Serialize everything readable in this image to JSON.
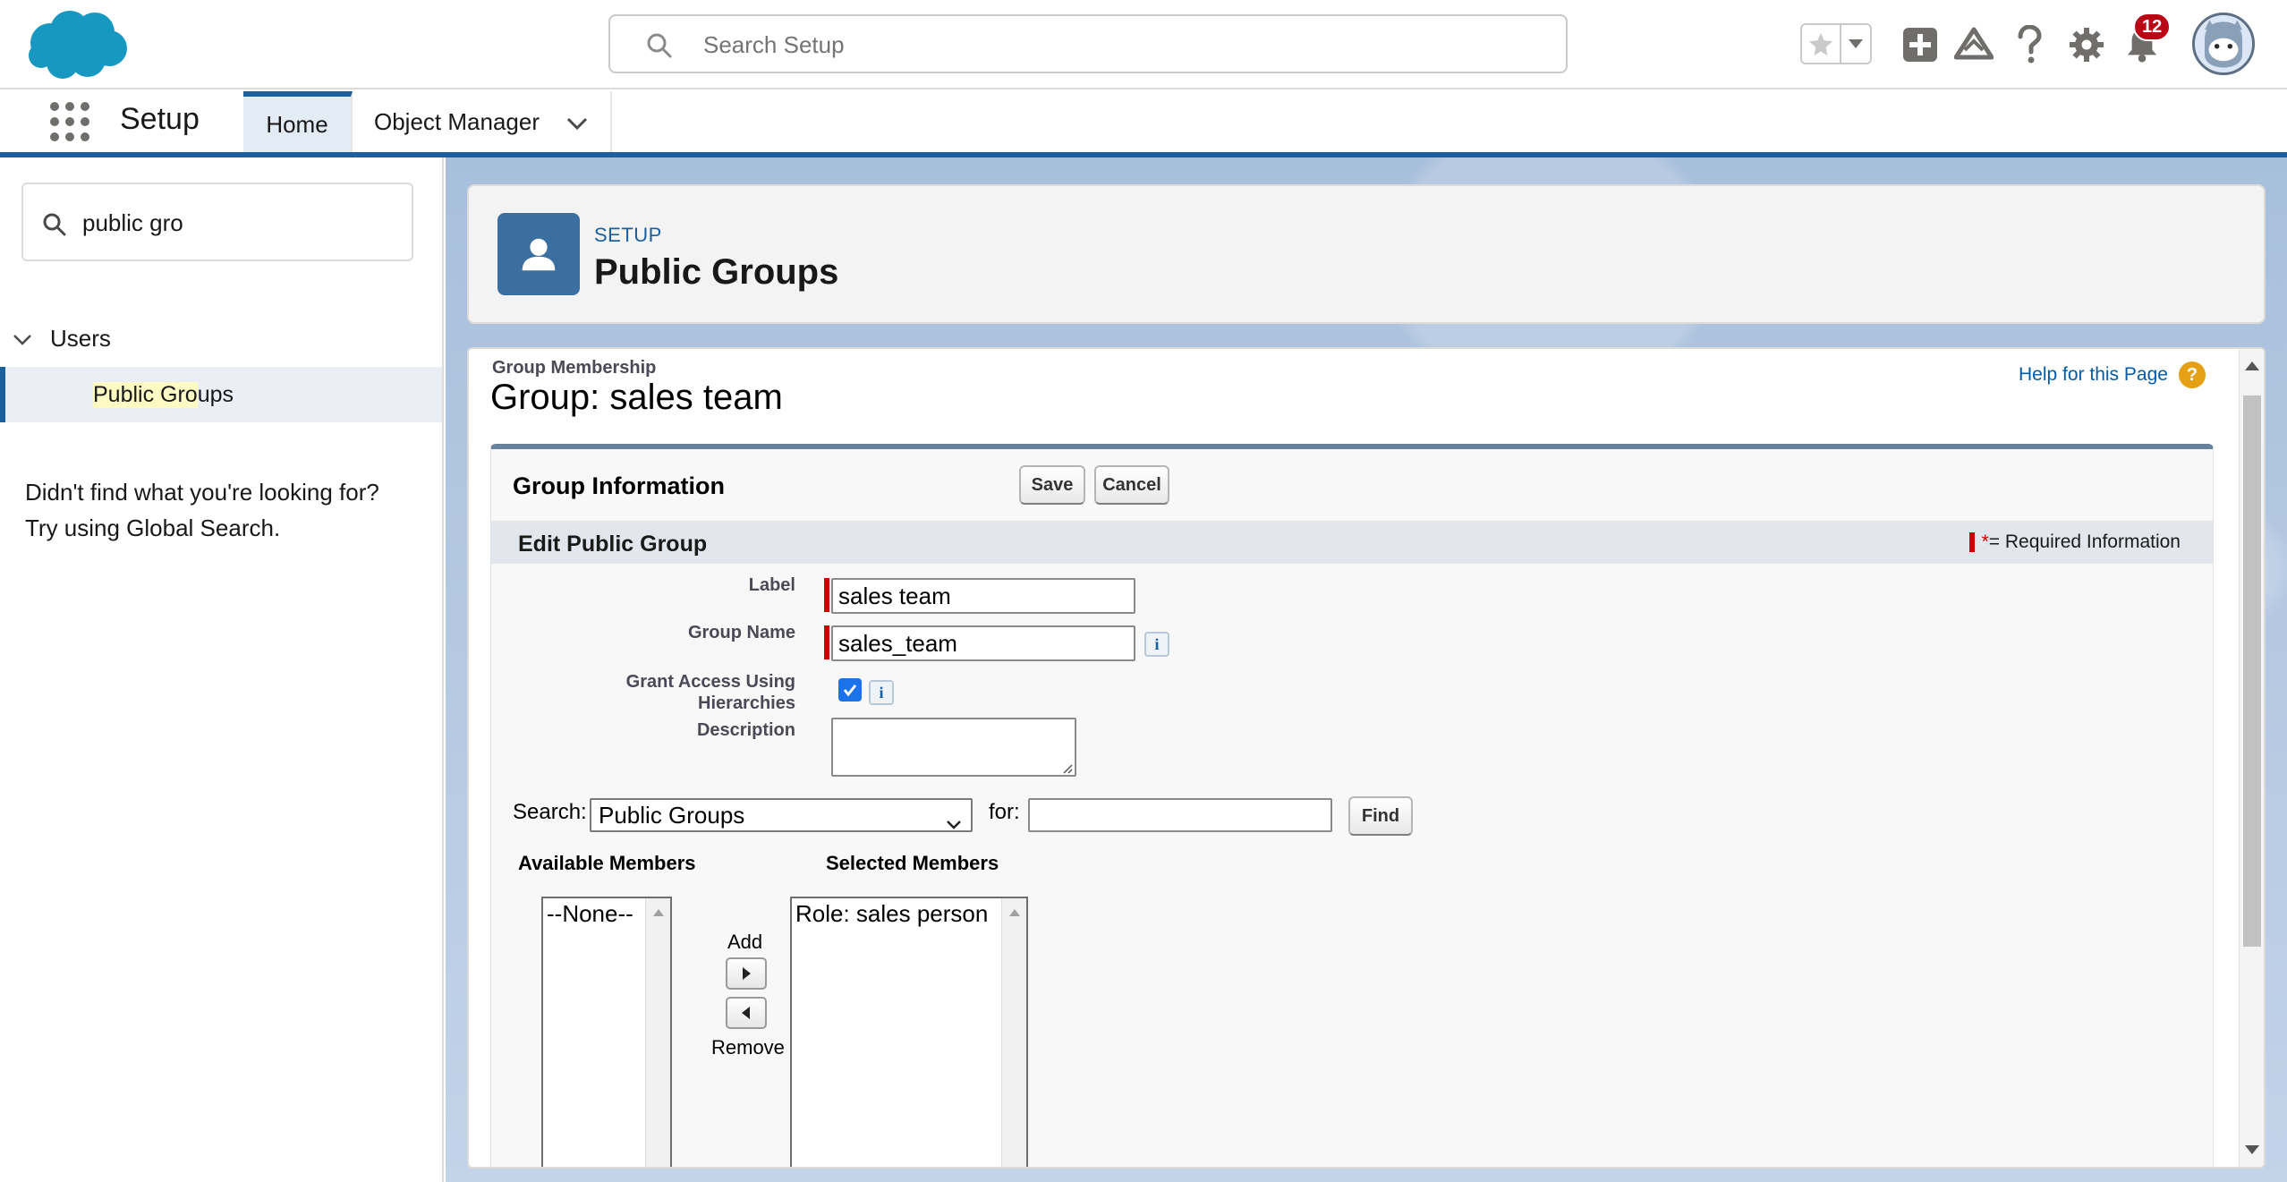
{
  "header": {
    "search_placeholder": "Search Setup",
    "notification_count": "12"
  },
  "context_bar": {
    "app_name": "Setup",
    "tabs": [
      {
        "label": "Home",
        "active": true
      },
      {
        "label": "Object Manager",
        "active": false
      }
    ]
  },
  "sidebar": {
    "quick_find_value": "public gro",
    "tree": {
      "parent_label": "Users",
      "child_label_highlight": "Public Gro",
      "child_label_rest": "ups"
    },
    "not_found_line1": "Didn't find what you're looking for?",
    "not_found_line2": "Try using Global Search."
  },
  "page_header": {
    "breadcrumb": "SETUP",
    "title": "Public Groups"
  },
  "content": {
    "subtitle": "Group Membership",
    "title": "Group: sales team",
    "help_link": "Help for this Page",
    "panel": {
      "title": "Group Information",
      "save_label": "Save",
      "cancel_label": "Cancel",
      "section_title": "Edit Public Group",
      "required_legend_star": "*",
      "required_legend_text": "= Required Information",
      "fields": {
        "label_label": "Label",
        "label_value": "sales team",
        "group_name_label": "Group Name",
        "group_name_value": "sales_team",
        "grant_access_label_line1": "Grant Access Using",
        "grant_access_label_line2": "Hierarchies",
        "grant_access_checked": true,
        "description_label": "Description",
        "description_value": ""
      },
      "member_search": {
        "search_label": "Search:",
        "search_selected": "Public Groups",
        "for_label": "for:",
        "for_value": "",
        "find_label": "Find"
      },
      "members": {
        "available_header": "Available Members",
        "available_items": [
          "--None--"
        ],
        "add_label": "Add",
        "remove_label": "Remove",
        "selected_header": "Selected Members",
        "selected_items": [
          "Role: sales person"
        ]
      }
    }
  },
  "colors": {
    "brand_blue": "#1b5f9e",
    "required_red": "#c00000",
    "notification_red": "#ba0517",
    "help_orange": "#e6a013",
    "checkbox_blue": "#1a73e8"
  }
}
